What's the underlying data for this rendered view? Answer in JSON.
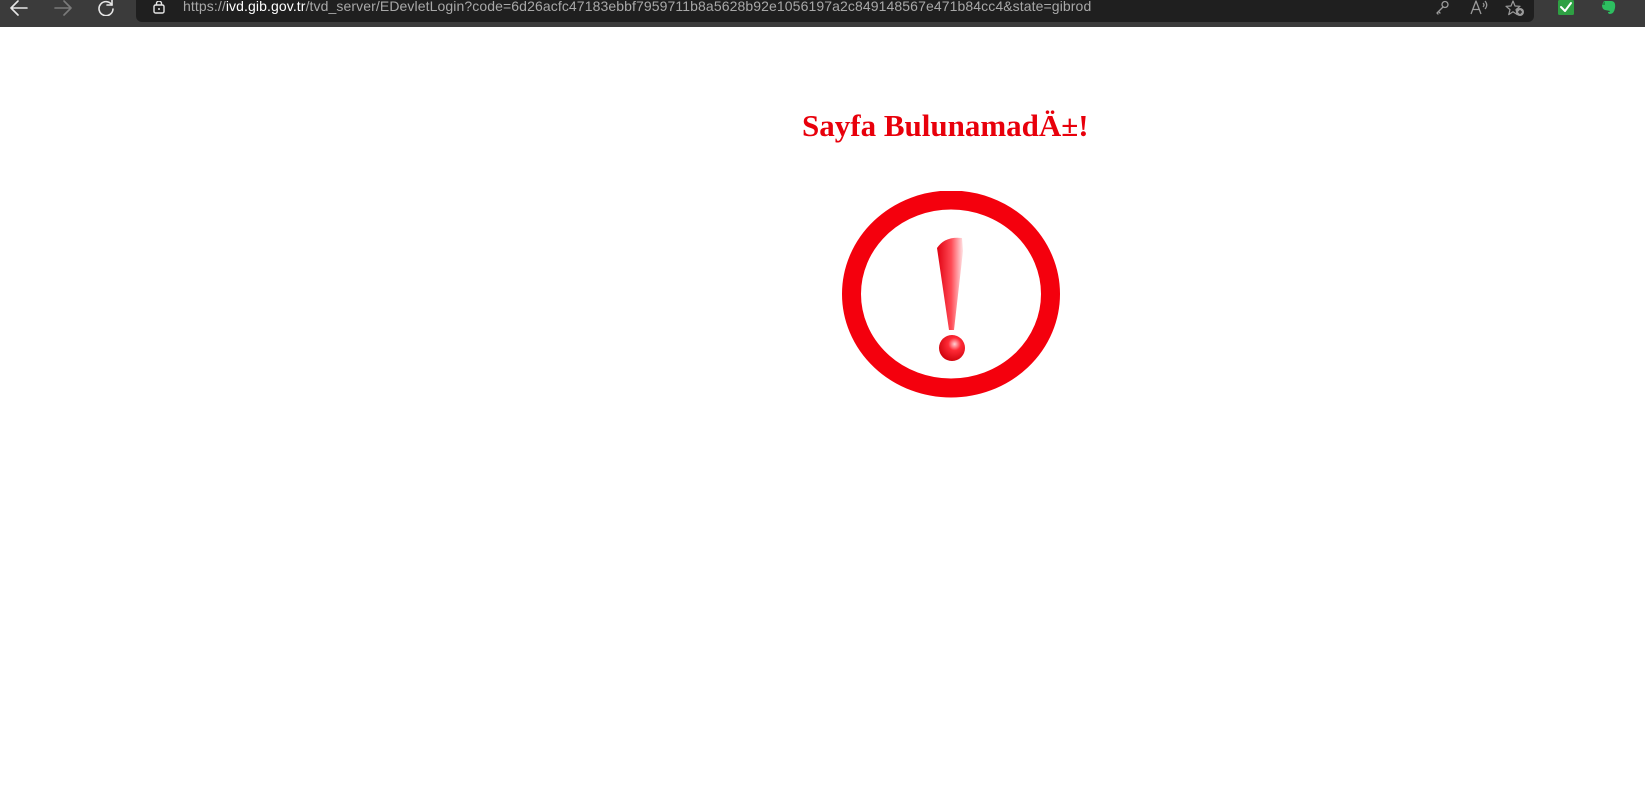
{
  "browser": {
    "url_scheme": "https://",
    "url_host": "ivd.gib.gov.tr",
    "url_path": "/tvd_server/EDevletLogin?code=6d26acfc47183ebbf7959711b8a5628b92e1056197a2c849148567e471b84cc4&state=gibrod",
    "icons": {
      "back": "back-arrow-icon",
      "forward": "forward-arrow-icon",
      "refresh": "refresh-icon",
      "lock": "lock-icon",
      "password": "key-icon",
      "read_aloud": "read-aloud-icon",
      "favorites": "add-favorite-icon",
      "extension_1": "green-check-extension-icon",
      "extension_2": "evernote-elephant-icon"
    }
  },
  "page": {
    "title": "Sayfa BulunamadÄ±!",
    "graphic": "exclamation-warning-icon",
    "accent_color": "#e8000b"
  }
}
